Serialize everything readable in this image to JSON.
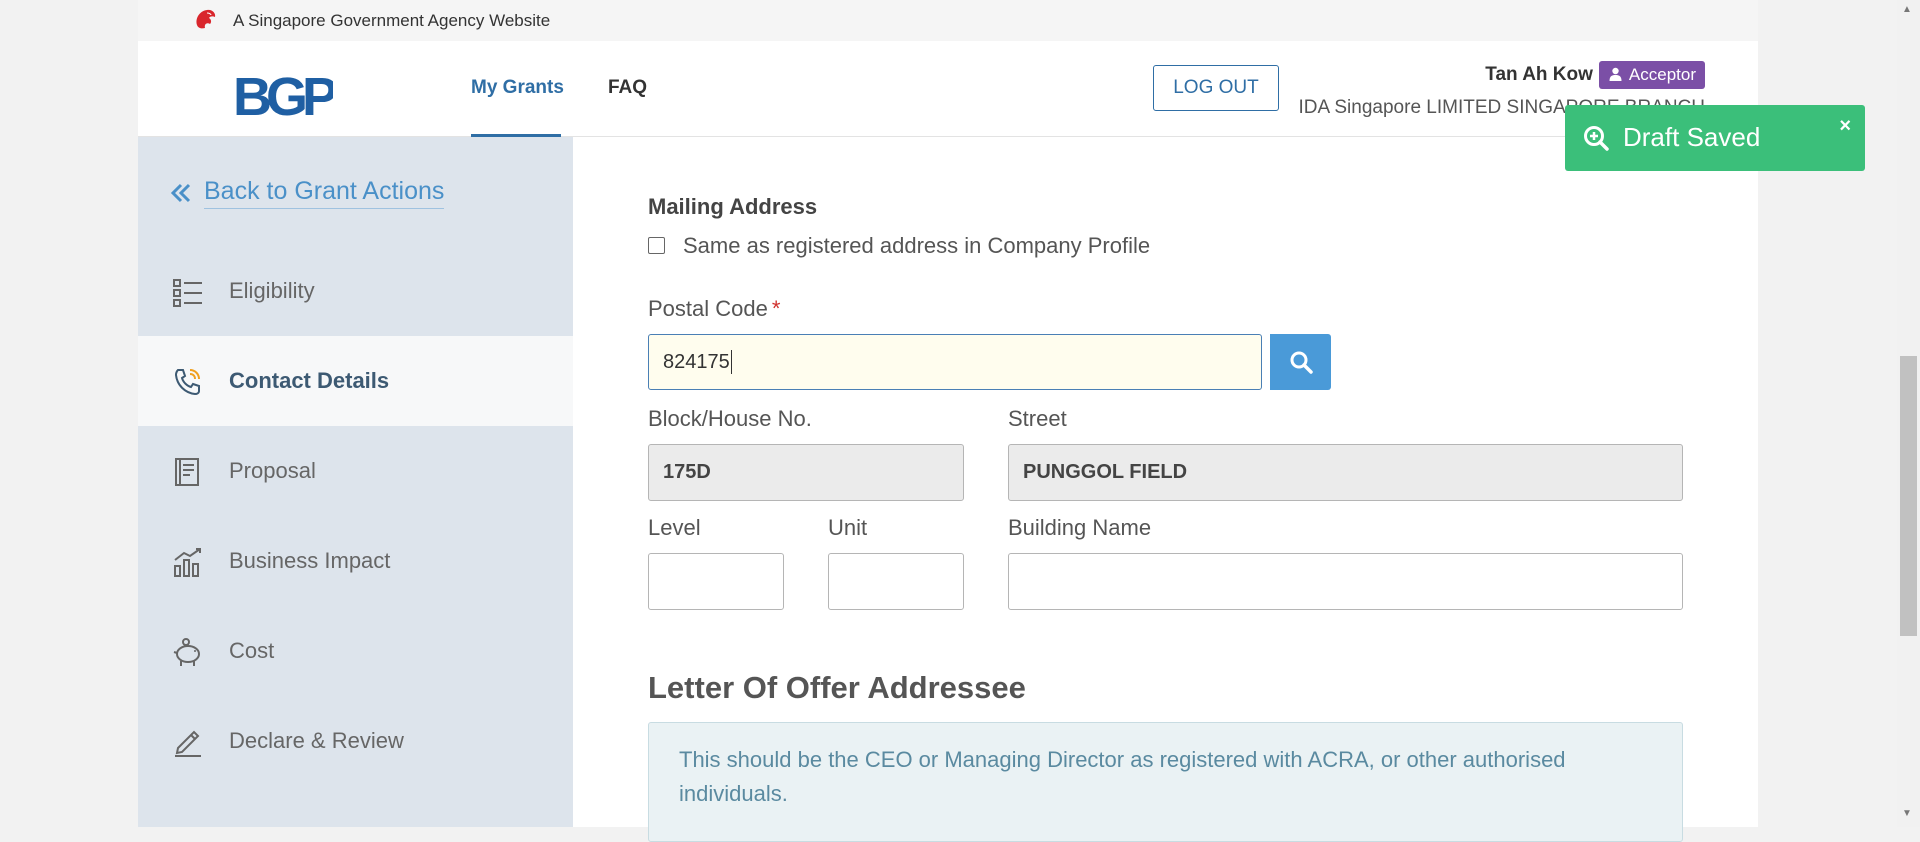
{
  "govbar": {
    "text": "A Singapore Government Agency Website"
  },
  "header": {
    "logo_text": "BGP",
    "nav": {
      "my_grants": "My Grants",
      "faq": "FAQ"
    },
    "logout_label": "LOG OUT",
    "user_name": "Tan Ah Kow",
    "role": "Acceptor",
    "org_name": "IDA Singapore LIMITED SINGAPORE BRANCH"
  },
  "sidebar": {
    "back_label": "Back to Grant Actions",
    "items": [
      {
        "label": "Eligibility",
        "icon": "checklist-icon"
      },
      {
        "label": "Contact Details",
        "icon": "phone-icon",
        "active": true
      },
      {
        "label": "Proposal",
        "icon": "document-icon"
      },
      {
        "label": "Business Impact",
        "icon": "chart-icon"
      },
      {
        "label": "Cost",
        "icon": "piggy-bank-icon"
      },
      {
        "label": "Declare & Review",
        "icon": "pen-icon"
      }
    ]
  },
  "form": {
    "mailing_address_label": "Mailing Address",
    "same_as_registered_label": "Same as registered address in Company Profile",
    "postal_code_label": "Postal Code",
    "required_mark": "*",
    "postal_code_value": "824175",
    "block_label": "Block/House No.",
    "block_value": "175D",
    "street_label": "Street",
    "street_value": "PUNGGOL FIELD",
    "level_label": "Level",
    "level_value": "",
    "unit_label": "Unit",
    "unit_value": "",
    "building_label": "Building Name",
    "building_value": ""
  },
  "letter_of_offer": {
    "title": "Letter Of Offer Addressee",
    "info": "This should be the CEO or Managing Director as registered with ACRA, or other authorised individuals."
  },
  "toast": {
    "text": "Draft Saved",
    "close": "×"
  },
  "colors": {
    "brand_blue": "#2f6ea5",
    "sidebar_bg": "#dde4ec",
    "toast_green": "#3bbf7a",
    "role_purple": "#7b4fa6",
    "search_blue": "#4a9ad8"
  }
}
